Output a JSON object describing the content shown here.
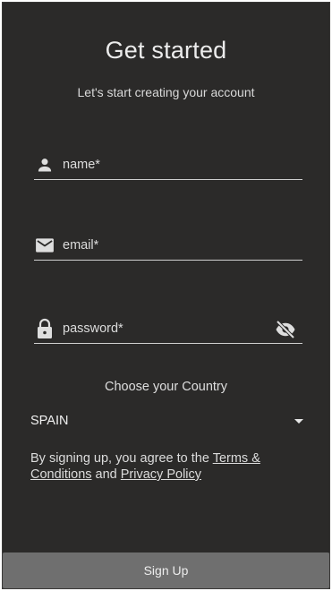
{
  "header": {
    "title": "Get started",
    "subtitle": "Let's start creating your account"
  },
  "form": {
    "name_placeholder": "name*",
    "email_placeholder": "email*",
    "password_placeholder": "password*",
    "country_label": "Choose your Country",
    "country_value": "SPAIN",
    "terms_prefix": "By signing up, you agree to the ",
    "terms_link": "Terms & Conditions",
    "terms_middle": " and ",
    "privacy_link": "Privacy Policy",
    "signup_label": "Sign Up"
  },
  "icons": {
    "name": "person-icon",
    "email": "mail-icon",
    "password": "lock-icon",
    "visibility": "visibility-off-icon",
    "dropdown": "dropdown-caret-icon"
  },
  "colors": {
    "background": "#2b2a29",
    "text": "#e9e9e9",
    "underline": "#cfcfcf",
    "button": "#6f6f6f"
  }
}
